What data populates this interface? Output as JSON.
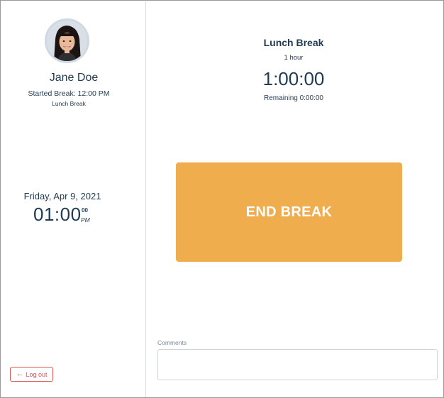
{
  "user": {
    "name": "Jane Doe",
    "started_break": "Started Break: 12:00 PM",
    "break_type": "Lunch Break"
  },
  "clock": {
    "date": "Friday, Apr 9, 2021",
    "time": "01:00",
    "seconds": "00",
    "ampm": "PM"
  },
  "logout": {
    "label": "Log out",
    "icon": "arrow-left-icon"
  },
  "break": {
    "title": "Lunch Break",
    "duration": "1 hour",
    "timer": "1:00:00",
    "remaining": "Remaining 0:00:00",
    "end_button_label": "END BREAK"
  },
  "comments": {
    "label": "Comments",
    "value": "",
    "placeholder": ""
  },
  "colors": {
    "accent": "#f0ad4e",
    "text": "#1f3a52",
    "danger": "#d9534f"
  }
}
